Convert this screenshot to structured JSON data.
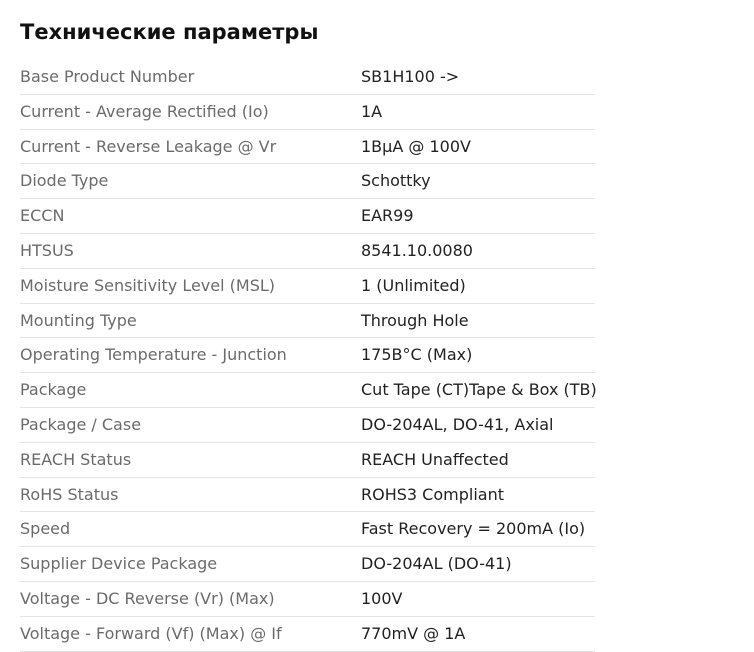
{
  "title": "Технические параметры",
  "specs": [
    {
      "label": "Base Product Number",
      "value": "SB1H100 ->"
    },
    {
      "label": "Current - Average Rectified (Io)",
      "value": "1A"
    },
    {
      "label": "Current - Reverse Leakage @ Vr",
      "value": "1BµA @ 100V"
    },
    {
      "label": "Diode Type",
      "value": "Schottky"
    },
    {
      "label": "ECCN",
      "value": "EAR99"
    },
    {
      "label": "HTSUS",
      "value": "8541.10.0080"
    },
    {
      "label": "Moisture Sensitivity Level (MSL)",
      "value": "1 (Unlimited)"
    },
    {
      "label": "Mounting Type",
      "value": "Through Hole"
    },
    {
      "label": "Operating Temperature - Junction",
      "value": "175B°C (Max)"
    },
    {
      "label": "Package",
      "value": "Cut Tape (CT)Tape & Box (TB)"
    },
    {
      "label": "Package / Case",
      "value": "DO-204AL, DO-41, Axial"
    },
    {
      "label": "REACH Status",
      "value": "REACH Unaffected"
    },
    {
      "label": "RoHS Status",
      "value": "ROHS3 Compliant"
    },
    {
      "label": "Speed",
      "value": "Fast Recovery = 200mA (Io)"
    },
    {
      "label": "Supplier Device Package",
      "value": "DO-204AL (DO-41)"
    },
    {
      "label": "Voltage - DC Reverse (Vr) (Max)",
      "value": "100V"
    },
    {
      "label": "Voltage - Forward (Vf) (Max) @ If",
      "value": "770mV @ 1A"
    }
  ]
}
